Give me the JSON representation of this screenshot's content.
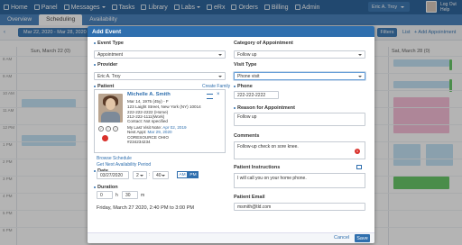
{
  "topnav": {
    "menu": [
      "Home",
      "Panel",
      "Messages",
      "Tasks",
      "Library",
      "Labs",
      "eRx",
      "Orders",
      "Billing",
      "Admin"
    ],
    "user": "Eric A. Troy",
    "logout": "Log Out",
    "help": "Help"
  },
  "subtabs": [
    "Overview",
    "Scheduling",
    "Availability"
  ],
  "toolbar": {
    "daterange": "Mar 22, 2020 - Mar 28, 2020",
    "filters": "Filters",
    "list": "List",
    "add": "+ Add Appointment"
  },
  "calendar": {
    "day1": "Sun, March 22 (0)",
    "day2": "Sat, March 28 (0)",
    "times": [
      "8 AM",
      "9 AM",
      "10 AM",
      "11 AM",
      "12 PM",
      "1 PM",
      "2 PM",
      "3 PM",
      "4 PM",
      "5 PM",
      "6 PM"
    ],
    "colors": {
      "green": "#5cc35c",
      "blue": "#bfe0f5",
      "pink": "#f6b9d4"
    }
  },
  "modal": {
    "title": "Add Event",
    "event_type_label": "Event Type",
    "event_type_value": "Appointment",
    "provider_label": "Provider",
    "provider_value": "Eric A. Troy",
    "patient_label": "Patient",
    "create_family": "Create Family",
    "patient": {
      "name": "Michelle A. Smith",
      "line1": "Mar 14, 1975 (45y) - F",
      "line2": "123 Laight Street, New York (NY) 10014",
      "line3": "222-222-2222 (Home)",
      "line4": "212-222-1111(Work)",
      "line5": "Contact: Not specified",
      "last_visit_label": "My Last Visit Note:",
      "last_visit_date": "Apr 02, 2019",
      "next_appt_label": "Next Appt:",
      "next_appt_date": "Mar 29, 2020",
      "insurer": "CORESOURCE OHIO",
      "policy": "#234234234"
    },
    "browse_schedule": "Browse Schedule",
    "get_next": "Get Next Availability Period",
    "date_label": "Date",
    "date_value": "03/27/2020",
    "hour": "2",
    "minute": "40",
    "am": "AM",
    "pm": "PM",
    "duration_label": "Duration",
    "dur_h": "0",
    "h": "h",
    "dur_m": "30",
    "m": "m",
    "summary": "Friday, March 27 2020, 2:40 PM to 3:00 PM",
    "category_label": "Category of Appointment",
    "category_value": "Follow up",
    "visit_type_label": "Visit Type",
    "visit_type_value": "Phone visit",
    "phone_label": "Phone",
    "phone_value": "222-222-2222",
    "reason_label": "Reason for Appointment",
    "reason_value": "Follow up",
    "comments_label": "Comments",
    "comments_value": "Follow-up check on sore knee.",
    "comments_badge": "1",
    "instructions_label": "Patient Instructions",
    "instructions_value": "I will call you on your home phone.",
    "email_label": "Patient Email",
    "email_value": "msmith@tld.com",
    "cancel": "Cancel",
    "save": "Save"
  }
}
